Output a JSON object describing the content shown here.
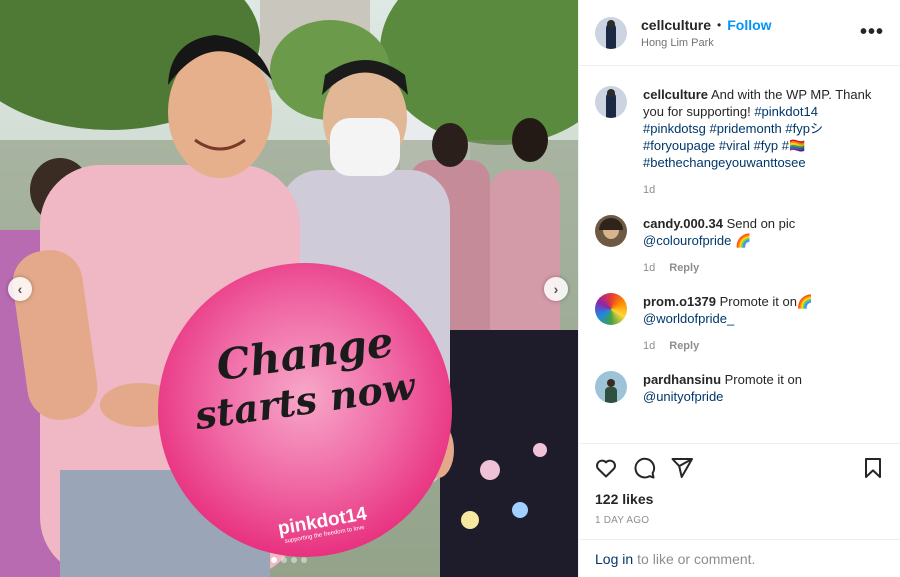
{
  "post": {
    "username": "cellculture",
    "separator": "•",
    "follow_label": "Follow",
    "location": "Hong Lim Park",
    "more_label": "•••"
  },
  "media": {
    "sign_line1": "Change",
    "sign_line2": "starts now",
    "sign_brand": "pinkdot14",
    "sign_tagline": "supporting the freedom to love",
    "prev_glyph": "‹",
    "next_glyph": "›",
    "dot_count": 4,
    "active_dot": 0
  },
  "caption": {
    "username": "cellculture",
    "text": "And with the WP MP. Thank you for supporting!",
    "tags": "#pinkdot14 #pinkdotsg #pridemonth #fypシ #foryoupage #viral #fyp #🏳️‍🌈 #bethechangeyouwanttosee",
    "time": "1d"
  },
  "comments": [
    {
      "username": "candy.000.34",
      "text": "Send on pic",
      "mention": "@colourofpride 🌈",
      "time": "1d",
      "reply_label": "Reply"
    },
    {
      "username": "prom.o1379",
      "text": "Promote it on🌈",
      "mention": "@worldofpride_",
      "time": "1d",
      "reply_label": "Reply"
    },
    {
      "username": "pardhansinu",
      "text": "Promote it on",
      "mention": "@unityofpride",
      "time": "",
      "reply_label": ""
    }
  ],
  "footer": {
    "likes": "122 likes",
    "date": "1 DAY AGO",
    "login_link": "Log in",
    "login_text": "to like or comment."
  },
  "colors": {
    "link": "#0095f6",
    "tag": "#00376b",
    "sign_pink": "#ee3d8c"
  },
  "icons": [
    "heart-icon",
    "comment-icon",
    "share-icon",
    "bookmark-icon",
    "more-icon",
    "chevron-left-icon",
    "chevron-right-icon"
  ]
}
